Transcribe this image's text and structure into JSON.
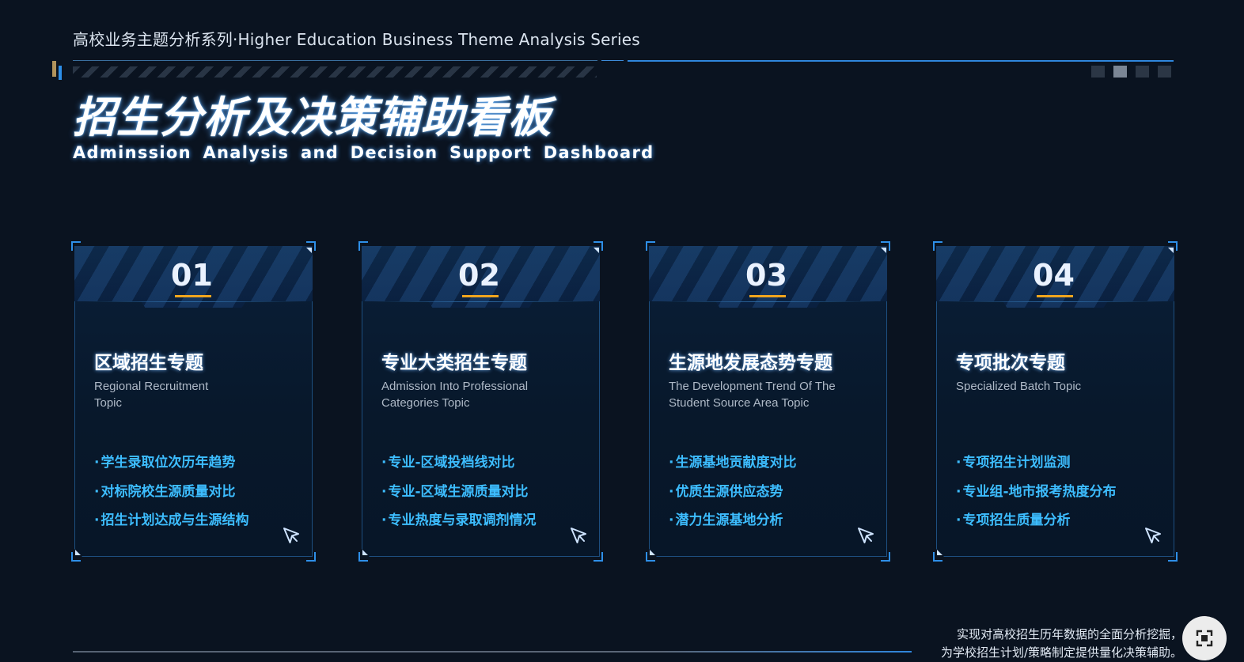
{
  "header": {
    "series": "高校业务主题分析系列·Higher Education Business Theme Analysis Series",
    "title": "招生分析及决策辅助看板",
    "subtitle": "Adminssion Analysis and Decision Support Dashboard"
  },
  "pager": {
    "count": 4,
    "active_index": 1
  },
  "cards": [
    {
      "number": "01",
      "title": "区域招生专题",
      "en": "Regional Recruitment Topic",
      "items": [
        "学生录取位次历年趋势",
        "对标院校生源质量对比",
        "招生计划达成与生源结构"
      ]
    },
    {
      "number": "02",
      "title": "专业大类招生专题",
      "en": "Admission Into Professional Categories Topic",
      "items": [
        "专业-区域投档线对比",
        "专业-区域生源质量对比",
        "专业热度与录取调剂情况"
      ]
    },
    {
      "number": "03",
      "title": "生源地发展态势专题",
      "en": "The Development Trend Of The Student Source Area Topic",
      "items": [
        "生源基地贡献度对比",
        "优质生源供应态势",
        "潜力生源基地分析"
      ]
    },
    {
      "number": "04",
      "title": "专项批次专题",
      "en": "Specialized Batch Topic",
      "items": [
        "专项招生计划监测",
        "专业组-地市报考热度分布",
        "专项招生质量分析"
      ]
    }
  ],
  "footer": {
    "line1": "实现对高校招生历年数据的全面分析挖掘，",
    "line2": "为学校招生计划/策略制定提供量化决策辅助。"
  },
  "colors": {
    "accent": "#2f86dd",
    "item": "#3dbdff",
    "underline": "#f0a51e",
    "background": "#0a1320"
  }
}
